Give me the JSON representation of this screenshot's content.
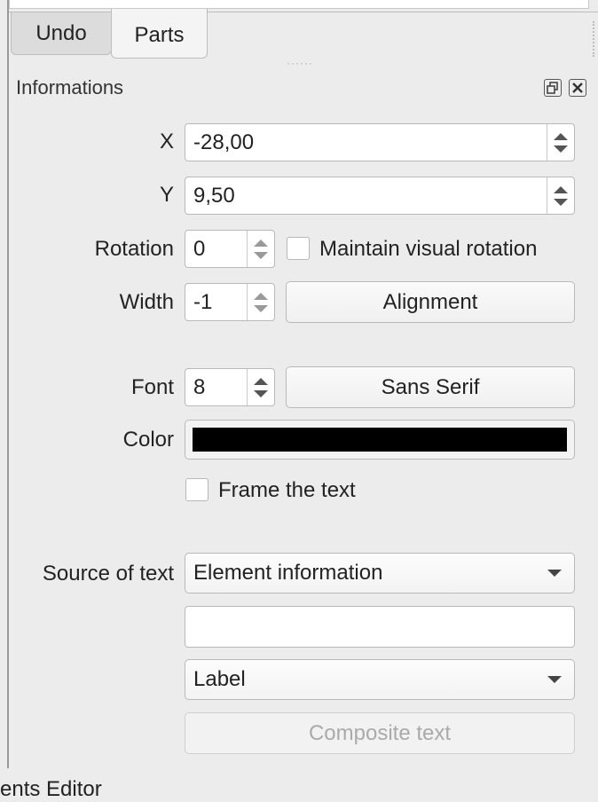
{
  "tabs": [
    {
      "label": "Undo",
      "active": false
    },
    {
      "label": "Parts",
      "active": true
    }
  ],
  "panel": {
    "title": "Informations",
    "float_icon": "float-icon",
    "close_icon": "close-icon"
  },
  "position": {
    "x_label": "X",
    "x_value": "-28,00",
    "y_label": "Y",
    "y_value": "9,50"
  },
  "rotation": {
    "label": "Rotation",
    "value": "0",
    "maintain_label": "Maintain visual rotation",
    "maintain_checked": false
  },
  "width": {
    "label": "Width",
    "value": "-1",
    "alignment_label": "Alignment"
  },
  "font": {
    "label": "Font",
    "size": "8",
    "family_label": "Sans Serif"
  },
  "color": {
    "label": "Color",
    "value": "#000000"
  },
  "frame": {
    "label": "Frame the text",
    "checked": false
  },
  "source": {
    "label": "Source of text",
    "selected": "Element information",
    "text_value": "",
    "info_selected": "Label",
    "composite_label": "Composite text"
  },
  "footer": {
    "text": "ents Editor"
  }
}
